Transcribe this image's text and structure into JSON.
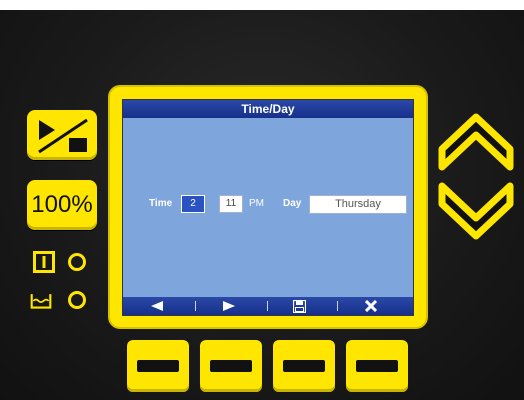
{
  "screen": {
    "title": "Time/Day",
    "time_label": "Time",
    "hour_value": "2",
    "minute_value": "11",
    "ampm": "PM",
    "day_label": "Day",
    "day_value": "Thursday"
  },
  "left_panel": {
    "speed_button_label": "100%"
  },
  "nav_bar": {
    "icons": [
      "left-arrow-icon",
      "right-arrow-icon",
      "save-icon",
      "close-icon"
    ]
  },
  "colors": {
    "accent_yellow": "#ffe600",
    "screen_background": "#7fa6dc",
    "titlebar_blue": "#1f3d9a",
    "selected_field": "#2a52c0"
  }
}
